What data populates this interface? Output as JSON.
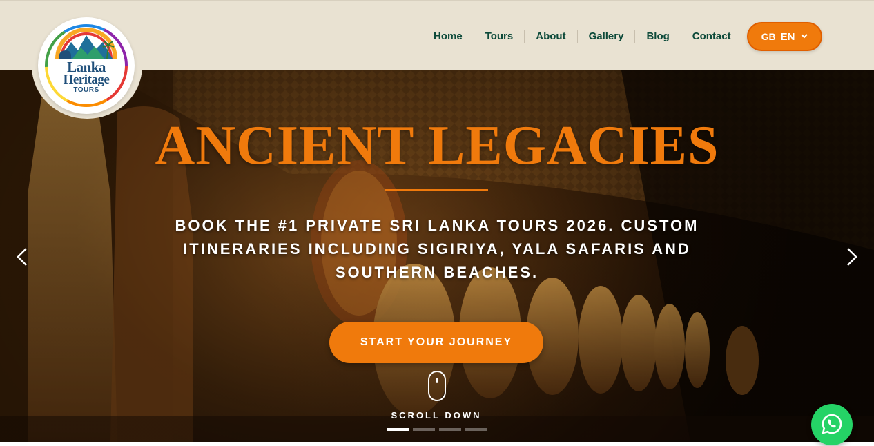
{
  "brand": {
    "line1": "Lanka",
    "line2": "Heritage",
    "line3": "TOURS",
    "logo_icon": "rainbow-mountain-elephant-logo"
  },
  "nav": {
    "items": [
      {
        "label": "Home"
      },
      {
        "label": "Tours"
      },
      {
        "label": "About"
      },
      {
        "label": "Gallery"
      },
      {
        "label": "Blog"
      },
      {
        "label": "Contact"
      }
    ]
  },
  "language": {
    "flag": "GB",
    "code": "EN",
    "icon": "chevron-down-icon"
  },
  "hero": {
    "title": "ANCIENT LEGACIES",
    "subtitle": "BOOK THE #1 PRIVATE SRI LANKA TOURS 2026. CUSTOM ITINERARIES INCLUDING SIGIRIYA, YALA SAFARIS AND SOUTHERN BEACHES.",
    "cta_label": "START YOUR JOURNEY",
    "scroll_label": "SCROLL DOWN",
    "slides_total": 4,
    "active_slide": 1
  },
  "colors": {
    "accent": "#f07a0c",
    "header_bg": "#e9e2d2",
    "nav_text": "#0d4a3a",
    "whatsapp": "#25d366"
  },
  "icons": {
    "prev": "chevron-left-icon",
    "next": "chevron-right-icon",
    "scroll": "mouse-icon",
    "chat": "whatsapp-icon"
  }
}
